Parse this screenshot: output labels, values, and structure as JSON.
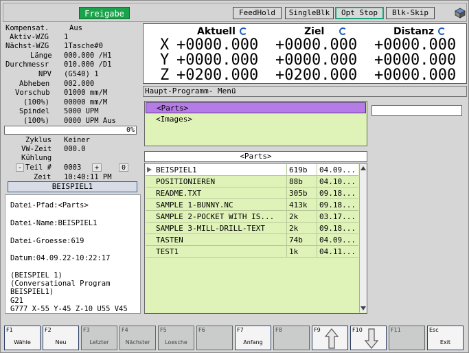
{
  "topbar": {
    "freigabe": "Freigabe",
    "buttons": [
      "FeedHold",
      "SingleBlk",
      "Opt Stop",
      "Blk-Skip"
    ]
  },
  "status": {
    "kompensat_label": "Kompensat.",
    "kompensat_value": "Aus",
    "aktiv_wzg_label": "Aktiv-WZG",
    "aktiv_wzg_value": "1",
    "naechst_wzg_label": "Nächst-WZG",
    "naechst_wzg_value": "1Tasche#0",
    "laenge_label": "Länge",
    "laenge_value": "000.000 /H1",
    "durchmessr_label": "Durchmessr",
    "durchmessr_value": "010.000 /D1",
    "npv_label": "NPV",
    "npv_value": "(G540) 1",
    "abheben_label": "Abheben",
    "abheben_value": "002.000",
    "vorschub_label": "Vorschub",
    "vorschub_value": "01000 mm/M",
    "vorschub_pct_label": "(100%)",
    "vorschub_pct_value": "00000 mm/M",
    "spindel_label": "Spindel",
    "spindel_value": "5000 UPM",
    "spindel_pct_label": "(100%)",
    "spindel_pct_value": "0000 UPM Aus",
    "progress_text": "0%",
    "zyklus_label": "Zyklus",
    "zyklus_value": "Keiner",
    "vw_zeit_label": "VW-Zeit",
    "vw_zeit_value": "000.0",
    "kuehlung_label": "Kühlung",
    "teil_minus": "-",
    "teil_label": "Teil #",
    "teil_value": "0003",
    "teil_plus": "+",
    "teil_zero": "0",
    "zeit_label": "Zeit",
    "zeit_value": "10:40:11 PM",
    "file_banner": "BEISPIEL1"
  },
  "info": {
    "lines": [
      "Datei-Pfad:<Parts>",
      "",
      "Datei-Name:BEISPIEL1",
      "",
      "Datei-Groesse:619",
      "",
      "Datum:04.09.22-10:22:17",
      "",
      "(BEISPIEL 1)",
      "(Conversational Program",
      "BEISPIEL1)",
      "G21",
      "G777 X-55 Y-45 Z-10 U55 V45"
    ]
  },
  "coords": {
    "headers": [
      "Aktuell",
      "Ziel",
      "Distanz"
    ],
    "axes": [
      "X",
      "Y",
      "Z"
    ],
    "aktuell": [
      "+0000.000",
      "+0000.000",
      "+0200.000"
    ],
    "ziel": [
      "+0000.000",
      "+0000.000",
      "+0200.000"
    ],
    "distanz": [
      "+0000.000",
      "+0000.000",
      "+0000.000"
    ]
  },
  "menu_title": "Haupt-Programm- Menü",
  "dirs": [
    "<Parts>",
    "<Images>"
  ],
  "parts_header": "<Parts>",
  "files": [
    {
      "name": "BEISPIEL1",
      "size": "619b",
      "date": "04.09..."
    },
    {
      "name": "POSITIONIEREN",
      "size": "88b",
      "date": "04.10..."
    },
    {
      "name": "README.TXT",
      "size": "305b",
      "date": "09.18..."
    },
    {
      "name": "SAMPLE 1-BUNNY.NC",
      "size": "413k",
      "date": "09.18..."
    },
    {
      "name": "SAMPLE 2-POCKET WITH IS...",
      "size": "2k",
      "date": "03.17..."
    },
    {
      "name": "SAMPLE 3-MILL-DRILL-TEXT",
      "size": "2k",
      "date": "09.18..."
    },
    {
      "name": "TASTEN",
      "size": "74b",
      "date": "04.09..."
    },
    {
      "name": "TEST1",
      "size": "1k",
      "date": "04.11..."
    }
  ],
  "fkeys": [
    {
      "key": "F1",
      "label": "Wähle"
    },
    {
      "key": "F2",
      "label": "Neu"
    },
    {
      "key": "F3",
      "label": "Letzter"
    },
    {
      "key": "F4",
      "label": "Nächster"
    },
    {
      "key": "F5",
      "label": "Loesche"
    },
    {
      "key": "F6",
      "label": ""
    },
    {
      "key": "F7",
      "label": "Anfang"
    },
    {
      "key": "F8",
      "label": ""
    },
    {
      "key": "F9",
      "label": ""
    },
    {
      "key": "F10",
      "label": ""
    },
    {
      "key": "F11",
      "label": ""
    },
    {
      "key": "Esc",
      "label": "Exit"
    }
  ],
  "colors": {
    "freigabe": "#1aa34a",
    "selected_dir": "#b57be6",
    "list_bg": "#dff2b8",
    "refresh": "#1f5fbf"
  }
}
